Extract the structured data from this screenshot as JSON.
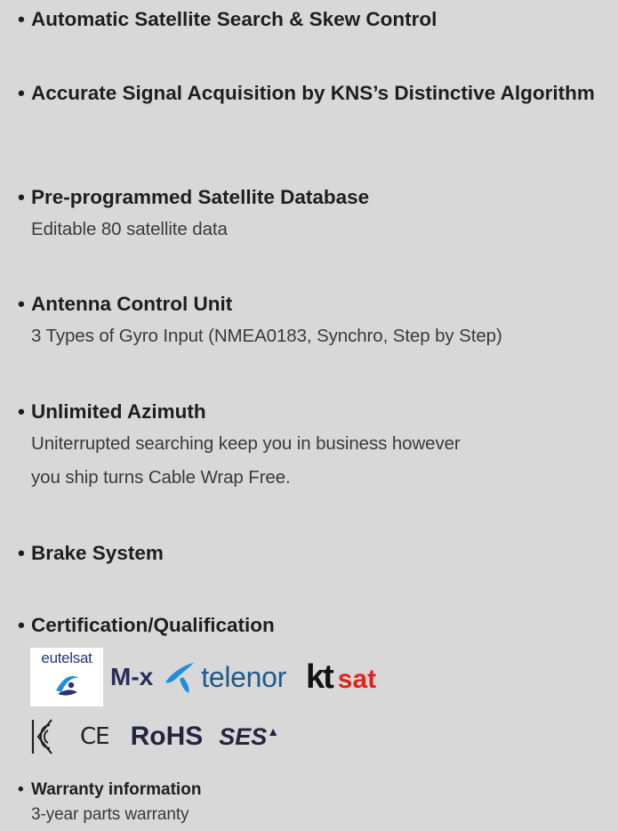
{
  "bullet": "•",
  "features": [
    {
      "title": "Automatic Satellite Search & Skew Control",
      "desc": []
    },
    {
      "title": "Accurate Signal Acquisition by KNS’s Distinctive Algorithm",
      "desc": []
    },
    {
      "title": "Pre-programmed Satellite Database",
      "desc": [
        "Editable 80 satellite data"
      ]
    },
    {
      "title": "Antenna Control Unit",
      "desc": [
        "3 Types of Gyro Input (NMEA0183, Synchro, Step by Step)"
      ]
    },
    {
      "title": "Unlimited Azimuth",
      "desc": [
        "Uniterrupted searching keep you in business however",
        "you ship turns Cable Wrap Free."
      ]
    },
    {
      "title": "Brake System",
      "desc": []
    },
    {
      "title": "Certification/Qualification",
      "desc": []
    }
  ],
  "logos": {
    "eutelsat": "eutelsat",
    "mx": "M-x",
    "telenor": "telenor",
    "kt": "kt",
    "sat": "sat",
    "ce": "CE",
    "rohs": "RoHS",
    "ses": "SES",
    "ses_mark": "▲",
    "icons": [
      "eutelsat-logo",
      "telenor-logo",
      "kc-mark-icon",
      "ce-mark"
    ]
  },
  "warranty": {
    "title": "Warranty information",
    "desc": "3-year parts warranty"
  },
  "colors": {
    "background": "#d8d8d8",
    "telenor_blue": "#1e8fd8",
    "kt_red": "#e2231a",
    "navy": "#24253f"
  }
}
